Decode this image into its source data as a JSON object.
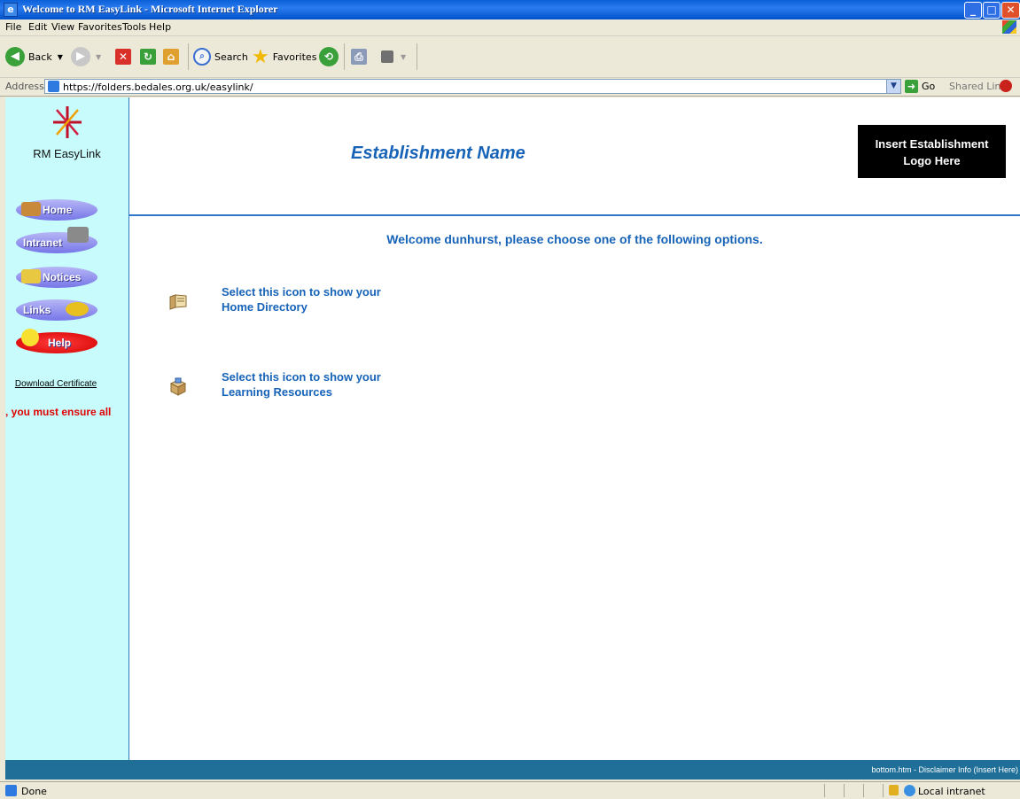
{
  "window": {
    "title": "Welcome to RM EasyLink - Microsoft Internet Explorer",
    "min_symbol": "_",
    "max_symbol": "□",
    "close_symbol": "✕"
  },
  "menu": [
    "File",
    "Edit",
    "View",
    "Favorites",
    "Tools",
    "Help"
  ],
  "toolbar": {
    "back_label": "Back",
    "search_label": "Search",
    "favorites_label": "Favorites"
  },
  "address": {
    "label": "Address",
    "url": "https://folders.bedales.org.uk/easylink/",
    "go_label": "Go",
    "shared_links": "Shared Links"
  },
  "sidebar": {
    "brand": "RM EasyLink",
    "nav": [
      {
        "label": "Home",
        "icon": "house-icon"
      },
      {
        "label": "Intranet",
        "icon": "computer-icon"
      },
      {
        "label": "Notices",
        "icon": "notices-icon"
      },
      {
        "label": "Links",
        "icon": "chain-link-icon"
      },
      {
        "label": "Help",
        "icon": "lightbulb-icon"
      }
    ],
    "download_link": "Download Certificate",
    "warning": ", you must ensure all"
  },
  "main": {
    "establishment_name": "Establishment Name",
    "logo_placeholder_line1": "Insert Establishment",
    "logo_placeholder_line2": "Logo Here",
    "welcome": "Welcome dunhurst, please choose one of the following options.",
    "options": [
      {
        "line1": "Select this icon to show your",
        "line2": "Home Directory",
        "icon": "folder-icon"
      },
      {
        "line1": "Select this icon to show your",
        "line2": "Learning Resources",
        "icon": "resources-box-icon"
      }
    ]
  },
  "footer": {
    "text": "bottom.htm - Disclaimer Info (Insert Here)"
  },
  "status": {
    "text": "Done",
    "zone": "Local intranet"
  },
  "colors": {
    "sidebar_bg": "#c8fcfc",
    "link_blue": "#1763b8",
    "footer_bg": "#1f6f98",
    "warning_red": "#e00000"
  }
}
